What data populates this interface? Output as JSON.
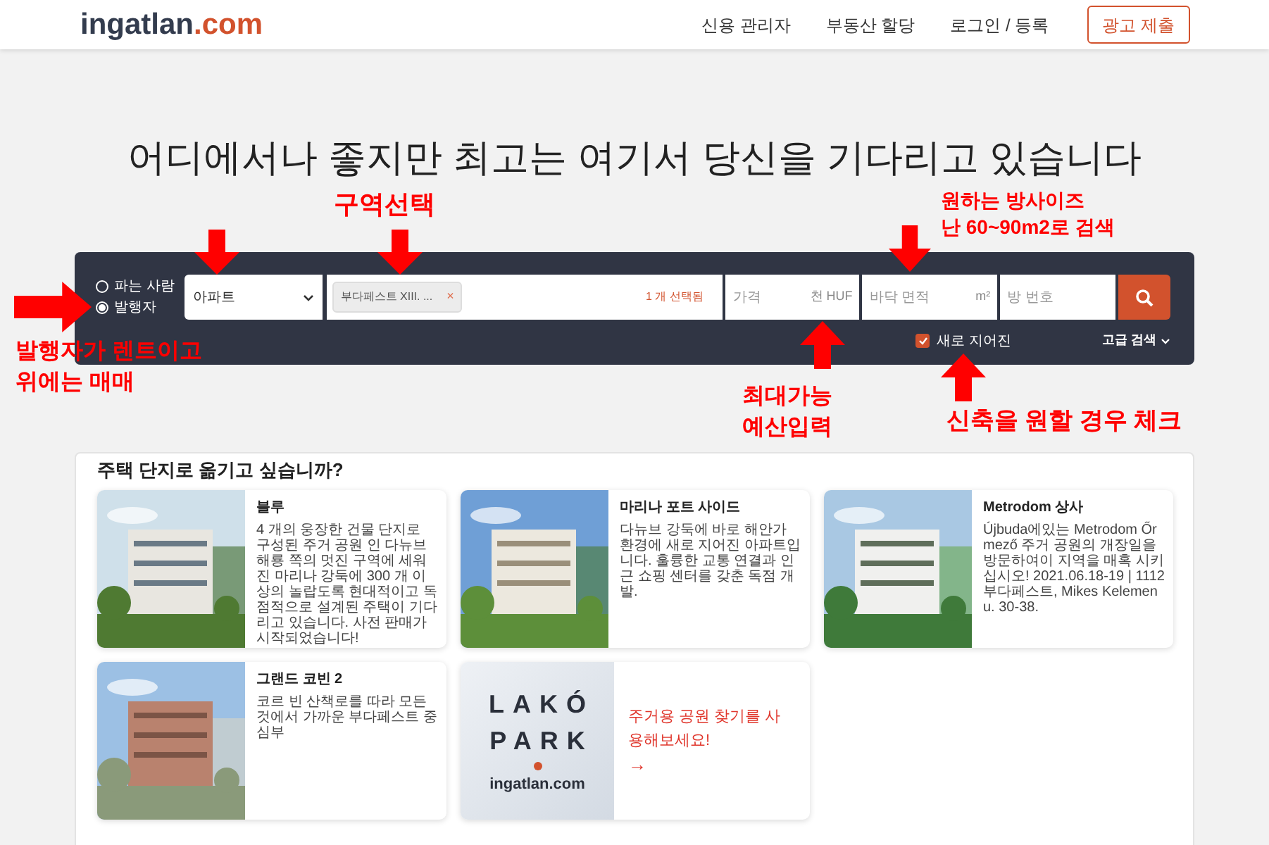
{
  "header": {
    "logo": {
      "brand": "ingatlan",
      "domain": ".com"
    },
    "nav": [
      "신용 관리자",
      "부동산 할당",
      "로그인 / 등록"
    ],
    "cta": "광고 제출"
  },
  "headline": "어디에서나 좋지만 최고는 여기서 당신을 기다리고 있습니다",
  "search": {
    "modes": [
      {
        "label": "파는 사람",
        "selected": false
      },
      {
        "label": "발행자",
        "selected": true
      }
    ],
    "type_select": {
      "value": "아파트"
    },
    "region": {
      "tag": "부다페스트 XIII. ...",
      "remove": "×",
      "count": "1 개 선택됨"
    },
    "price": {
      "placeholder": "가격",
      "unit": "천 HUF"
    },
    "area": {
      "placeholder": "바닥 면적",
      "unit": "m²"
    },
    "rooms": {
      "placeholder": "방 번호"
    },
    "new_build": {
      "label": "새로 지어진",
      "checked": true
    },
    "advanced": "고급 검색"
  },
  "projects": {
    "title": "주택 단지로 옮기고 싶습니까?",
    "cards": [
      {
        "kind": "project",
        "title": "블루",
        "description": "4 개의 웅장한 건물 단지로 구성된 주거 공원 인 다뉴브 해룡 쪽의 멋진 구역에 세워진 마리나 강둑에 300 개 이상의 놀랍도록 현대적이고 독점적으로 설계된 주택이 기다리고 있습니다. 사전 판매가 시작되었습니다!"
      },
      {
        "kind": "project",
        "title": "마리나 포트 사이드",
        "description": "다뉴브 강둑에 바로 해안가 환경에 새로 지어진 아파트입니다. 훌륭한 교통 연결과 인근 쇼핑 센터를 갖춘 독점 개발."
      },
      {
        "kind": "project",
        "title": "Metrodom 상사",
        "description": "Újbuda에있는 Metrodom Őrmező 주거 공원의 개장일을 방문하여이 지역을 매혹 시키십시오! 2021.06.18-19 | 1112 부다페스트, Mikes Kelemen u. 30-38."
      },
      {
        "kind": "project",
        "title": "그랜드 코빈 2",
        "description": "코르 빈 산책로를 따라 모든 것에서 가까운 부다페스트 중심부"
      },
      {
        "kind": "promo",
        "logo_lines": [
          "LAKÓ",
          "PARK"
        ],
        "logo_site": "ingatlan.com",
        "text": "주거용 공원 찾기를 사용해보세요!",
        "arrow": "→"
      }
    ]
  },
  "annotations": [
    {
      "text": "구역선택"
    },
    {
      "text": "원하는 방사이즈\n난 60~90m2로 검색"
    },
    {
      "text": "발행자가 렌트이고\n위에는 매매"
    },
    {
      "text": "최대가능\n예산입력"
    },
    {
      "text": "신축을 원할 경우 체크"
    }
  ]
}
